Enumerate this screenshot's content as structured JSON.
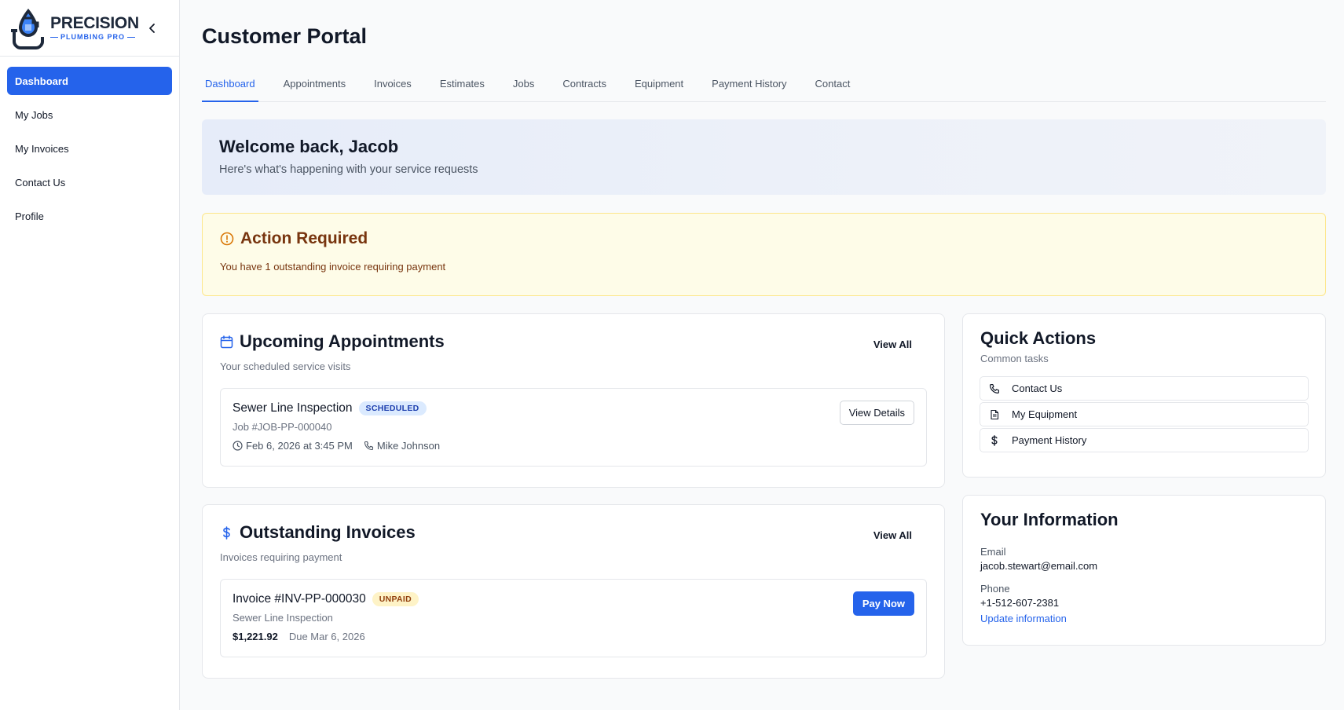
{
  "brand": {
    "line1": "PRECISION",
    "line2": "PLUMBING PRO",
    "primary_color": "#2563eb"
  },
  "sidebar": {
    "items": [
      {
        "label": "Dashboard",
        "active": true
      },
      {
        "label": "My Jobs"
      },
      {
        "label": "My Invoices"
      },
      {
        "label": "Contact Us"
      },
      {
        "label": "Profile"
      }
    ]
  },
  "page": {
    "title": "Customer Portal"
  },
  "tabs": [
    {
      "label": "Dashboard",
      "active": true
    },
    {
      "label": "Appointments"
    },
    {
      "label": "Invoices"
    },
    {
      "label": "Estimates"
    },
    {
      "label": "Jobs"
    },
    {
      "label": "Contracts"
    },
    {
      "label": "Equipment"
    },
    {
      "label": "Payment History"
    },
    {
      "label": "Contact"
    }
  ],
  "welcome": {
    "title": "Welcome back, Jacob",
    "subtitle": "Here's what's happening with your service requests"
  },
  "alert": {
    "title": "Action Required",
    "message": "You have 1 outstanding invoice requiring payment",
    "icon": "alert-circle-icon"
  },
  "appointments": {
    "title": "Upcoming Appointments",
    "subtitle": "Your scheduled service visits",
    "view_all": "View All",
    "items": [
      {
        "title": "Sewer Line Inspection",
        "status": "SCHEDULED",
        "job": "Job #JOB-PP-000040",
        "datetime": "Feb 6, 2026 at 3:45 PM",
        "technician": "Mike Johnson",
        "action": "View Details"
      }
    ]
  },
  "invoices": {
    "title": "Outstanding Invoices",
    "subtitle": "Invoices requiring payment",
    "view_all": "View All",
    "items": [
      {
        "title": "Invoice #INV-PP-000030",
        "status": "UNPAID",
        "service": "Sewer Line Inspection",
        "amount": "$1,221.92",
        "due": "Due Mar 6, 2026",
        "action": "Pay Now"
      }
    ]
  },
  "quick_actions": {
    "title": "Quick Actions",
    "subtitle": "Common tasks",
    "items": [
      {
        "label": "Contact Us",
        "icon": "phone-icon"
      },
      {
        "label": "My Equipment",
        "icon": "document-icon"
      },
      {
        "label": "Payment History",
        "icon": "dollar-icon"
      }
    ]
  },
  "your_information": {
    "title": "Your Information",
    "email_label": "Email",
    "email": "jacob.stewart@email.com",
    "phone_label": "Phone",
    "phone": "+1-512-607-2381",
    "update_link": "Update information"
  }
}
